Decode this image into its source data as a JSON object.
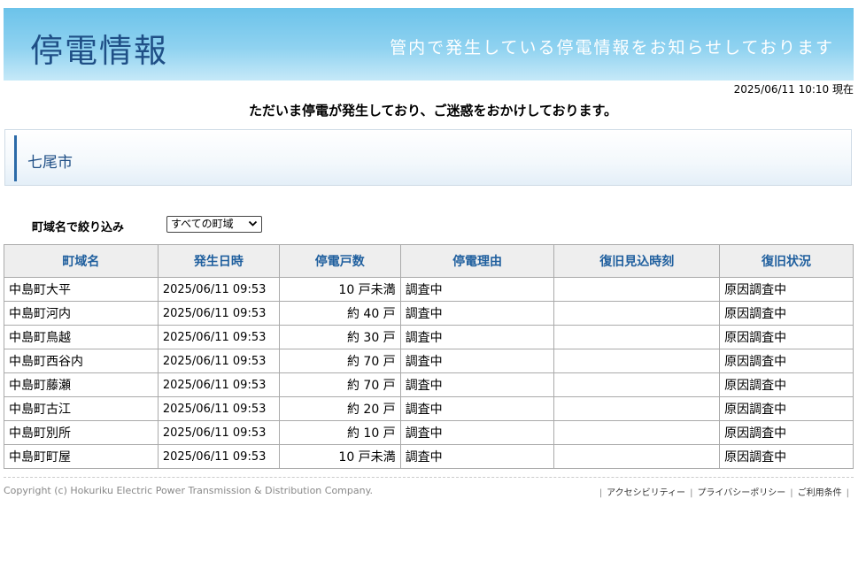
{
  "header": {
    "title": "停電情報",
    "subtitle": "管内で発生している停電情報をお知らせしております"
  },
  "timestamp": "2025/06/11 10:10 現在",
  "notice": "ただいま停電が発生しており、ご迷惑をおかけしております。",
  "area": {
    "name": "七尾市"
  },
  "filter": {
    "label": "町域名で絞り込み",
    "selected": "すべての町域"
  },
  "table": {
    "headers": [
      "町域名",
      "発生日時",
      "停電戸数",
      "停電理由",
      "復旧見込時刻",
      "復旧状況"
    ],
    "rows": [
      {
        "town": "中島町大平",
        "time": "2025/06/11 09:53",
        "count": "10 戸未満",
        "reason": "調査中",
        "eta": "",
        "status": "原因調査中"
      },
      {
        "town": "中島町河内",
        "time": "2025/06/11 09:53",
        "count": "約 40 戸",
        "reason": "調査中",
        "eta": "",
        "status": "原因調査中"
      },
      {
        "town": "中島町鳥越",
        "time": "2025/06/11 09:53",
        "count": "約 30 戸",
        "reason": "調査中",
        "eta": "",
        "status": "原因調査中"
      },
      {
        "town": "中島町西谷内",
        "time": "2025/06/11 09:53",
        "count": "約 70 戸",
        "reason": "調査中",
        "eta": "",
        "status": "原因調査中"
      },
      {
        "town": "中島町藤瀬",
        "time": "2025/06/11 09:53",
        "count": "約 70 戸",
        "reason": "調査中",
        "eta": "",
        "status": "原因調査中"
      },
      {
        "town": "中島町古江",
        "time": "2025/06/11 09:53",
        "count": "約 20 戸",
        "reason": "調査中",
        "eta": "",
        "status": "原因調査中"
      },
      {
        "town": "中島町別所",
        "time": "2025/06/11 09:53",
        "count": "約 10 戸",
        "reason": "調査中",
        "eta": "",
        "status": "原因調査中"
      },
      {
        "town": "中島町町屋",
        "time": "2025/06/11 09:53",
        "count": "10 戸未満",
        "reason": "調査中",
        "eta": "",
        "status": "原因調査中"
      }
    ]
  },
  "footer": {
    "copyright": "Copyright (c) Hokuriku Electric Power Transmission & Distribution Company.",
    "links": [
      "アクセシビリティー",
      "プライバシーポリシー",
      "ご利用条件"
    ]
  }
}
